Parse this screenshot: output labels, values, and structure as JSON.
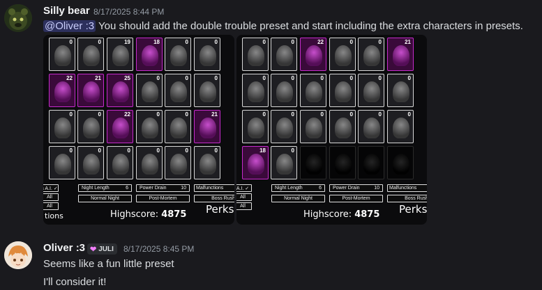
{
  "messages": [
    {
      "username": "Silly bear",
      "timestamp": "8/17/2025 8:44 PM",
      "mention": "@Oliver :3",
      "text": " You should add the double trouble preset and start including the extra characters in presets."
    },
    {
      "username": "Oliver :3",
      "badge": "JULI",
      "timestamp": "8/17/2025 8:45 PM",
      "lines": [
        "Seems like a fun little preset",
        "I'll consider it!"
      ]
    }
  ],
  "screenshots": [
    {
      "rows": [
        [
          {
            "n": "0",
            "s": "n"
          },
          {
            "n": "0",
            "s": "n"
          },
          {
            "n": "19",
            "s": "n"
          },
          {
            "n": "18",
            "s": "p"
          },
          {
            "n": "0",
            "s": "n"
          },
          {
            "n": "0",
            "s": "n"
          }
        ],
        [
          {
            "n": "22",
            "s": "p"
          },
          {
            "n": "21",
            "s": "p"
          },
          {
            "n": "25",
            "s": "p"
          },
          {
            "n": "0",
            "s": "n"
          },
          {
            "n": "0",
            "s": "n"
          },
          {
            "n": "0",
            "s": "n"
          }
        ],
        [
          {
            "n": "0",
            "s": "n"
          },
          {
            "n": "0",
            "s": "n"
          },
          {
            "n": "22",
            "s": "p"
          },
          {
            "n": "0",
            "s": "n"
          },
          {
            "n": "0",
            "s": "n"
          },
          {
            "n": "21",
            "s": "p"
          }
        ],
        [
          {
            "n": "0",
            "s": "n"
          },
          {
            "n": "0",
            "s": "n"
          },
          {
            "n": "0",
            "s": "n"
          },
          {
            "n": "0",
            "s": "n"
          },
          {
            "n": "0",
            "s": "n"
          },
          {
            "n": "0",
            "s": "n"
          }
        ]
      ],
      "left_buttons": [
        "s A.I. ✓",
        "All",
        "All"
      ],
      "tions_text": "tions",
      "night_length_label": "Night Length",
      "night_length_value": "6",
      "power_drain_label": "Power Drain",
      "power_drain_value": "10",
      "malfunctions_label": "Malfunctions",
      "normal_night": "Normal Night",
      "post_mortem": "Post-Mortem",
      "boss_rush": "Boss Rush",
      "highscore_label": "Highscore:",
      "highscore_value": "4875",
      "perks": "Perks"
    },
    {
      "rows": [
        [
          {
            "n": "0",
            "s": "n"
          },
          {
            "n": "0",
            "s": "n"
          },
          {
            "n": "22",
            "s": "p"
          },
          {
            "n": "0",
            "s": "n"
          },
          {
            "n": "0",
            "s": "n"
          },
          {
            "n": "21",
            "s": "p"
          }
        ],
        [
          {
            "n": "0",
            "s": "n"
          },
          {
            "n": "0",
            "s": "n"
          },
          {
            "n": "0",
            "s": "n"
          },
          {
            "n": "0",
            "s": "n"
          },
          {
            "n": "0",
            "s": "n"
          },
          {
            "n": "0",
            "s": "n"
          }
        ],
        [
          {
            "n": "0",
            "s": "n"
          },
          {
            "n": "0",
            "s": "n"
          },
          {
            "n": "0",
            "s": "n"
          },
          {
            "n": "0",
            "s": "n"
          },
          {
            "n": "0",
            "s": "n"
          },
          {
            "n": "0",
            "s": "n"
          }
        ],
        [
          {
            "n": "18",
            "s": "p"
          },
          {
            "n": "0",
            "s": "n"
          },
          {
            "n": "",
            "s": "e"
          },
          {
            "n": "",
            "s": "e"
          },
          {
            "n": "",
            "s": "e"
          },
          {
            "n": "",
            "s": "e"
          }
        ]
      ],
      "left_buttons": [
        "A.I. ✓",
        "All",
        "All"
      ],
      "tions_text": "",
      "night_length_label": "Night Length",
      "night_length_value": "6",
      "power_drain_label": "Power Drain",
      "power_drain_value": "10",
      "malfunctions_label": "Malfunctions",
      "normal_night": "Normal Night",
      "post_mortem": "Post-Mortem",
      "boss_rush": "Boss Rush",
      "highscore_label": "Highscore:",
      "highscore_value": "4875",
      "perks": "Perks"
    }
  ],
  "colors": {
    "purple_card": "#c52bcb",
    "mention_bg": "#5865f2"
  }
}
